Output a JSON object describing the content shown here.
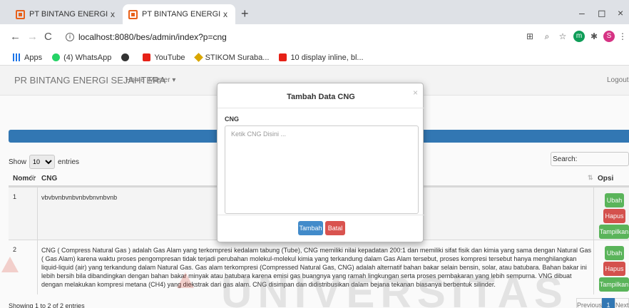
{
  "browser": {
    "tabs": [
      {
        "label": "PT BINTANG ENERGI SEJAHTERA",
        "active": false
      },
      {
        "label": "PT BINTANG ENERGI SEJAHTERA",
        "active": true
      }
    ],
    "new_tab": "+",
    "close_glyph": "x",
    "window_controls": {
      "minimize": "–",
      "restore": "◻",
      "close": "×"
    },
    "url": "localhost:8080/bes/admin/index?p=cng",
    "extensions": [
      {
        "name": "translate-icon",
        "glyph": "⊞"
      },
      {
        "name": "zoom-icon",
        "glyph": "⌕"
      },
      {
        "name": "star-icon",
        "glyph": "☆"
      },
      {
        "name": "extension-m-icon",
        "glyph": "m",
        "color": "#0f9d58"
      },
      {
        "name": "puzzle-icon",
        "glyph": "✱"
      },
      {
        "name": "profile-avatar",
        "glyph": "S",
        "color": "#d63384"
      },
      {
        "name": "menu-icon",
        "glyph": "⋮"
      }
    ],
    "bookmarks": [
      {
        "label": "Apps",
        "icon": "grid-icon"
      },
      {
        "label": "(4) WhatsApp",
        "icon": "whatsapp-icon"
      },
      {
        "label": "",
        "icon": "github-icon"
      },
      {
        "label": "YouTube",
        "icon": "youtube-icon"
      },
      {
        "label": "STIKOM Suraba...",
        "icon": "stikom-icon"
      },
      {
        "label": "10 display inline, bl...",
        "icon": "youtube-icon"
      }
    ]
  },
  "navbar": {
    "brand": "PR BINTANG ENERGI SEJAHTERA",
    "home": "Home",
    "master": "Master ▾",
    "logout": "Logout"
  },
  "table": {
    "show_label": "Show",
    "show_value": "10",
    "entries_label": "entries",
    "search_label": "Search:",
    "columns": [
      "Nomor",
      "CNG",
      "Opsi"
    ],
    "rows": [
      {
        "no": "1",
        "cng": "vbvbvnbvnbvnbvbnvnbvnb"
      },
      {
        "no": "2",
        "cng": "CNG ( Compress Natural Gas ) adalah Gas Alam yang terkompresi kedalam tabung (Tube), CNG memiliki nilai kepadatan 200:1 dan memiliki sifat fisik dan kimia yang sama dengan Natural Gas ( Gas Alam) karena waktu proses pengompresan tidak terjadi perubahan molekul-molekul kimia yang terkandung dalam Gas Alam tersebut, proses kompresi tersebut hanya menghilangkan liquid-liquid (air) yang terkandung dalam Natural Gas. Gas alam terkompresi (Compressed Natural Gas, CNG) adalah alternatif bahan bakar selain bensin, solar, atau batubara. Bahan bakar ini lebih bersih bila dibandingkan dengan bahan bakar minyak atau batubara karena emisi gas buangnya yang ramah lingkungan serta proses pembakaran yang lebih sempurna. VNG dibuat dengan melakukan kompresi metana (CH4) yang diekstrak dari gas alam. CNG disimpan dan didistribusikan dalam bejana tekanan biasanya berbentuk silinder."
      }
    ],
    "actions": {
      "edit": "Ubah",
      "delete": "Hapus",
      "view": "Tampilkan"
    },
    "info": "Showing 1 to 2 of 2 entries",
    "pagination": {
      "previous": "Previous",
      "page": "1",
      "next": "Next"
    }
  },
  "watermark": "UNIVERSITAS",
  "modal": {
    "title": "Tambah Data CNG",
    "close": "×",
    "field_label": "CNG",
    "placeholder": "Ketik CNG Disini ...",
    "submit": "Tambah",
    "cancel": "Batal"
  },
  "colors": {
    "primary": "#337ab7",
    "success": "#5cb85c",
    "danger": "#d9534f",
    "favicon": "#e8611a"
  }
}
